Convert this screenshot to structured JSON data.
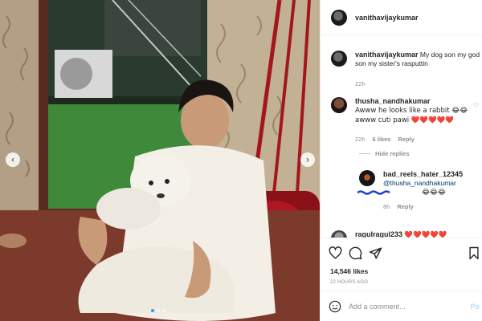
{
  "post": {
    "author": "vanithavijaykumar",
    "caption": "My dog son my god son my sister's rasputtin",
    "caption_age": "22h"
  },
  "comments": [
    {
      "username": "thusha_nandhakumar",
      "text": "Awww he looks like a rabbit 😂😂 awww cuti pawi ❤️❤️❤️❤️❤️",
      "age": "22h",
      "likes": "6 likes",
      "reply_label": "Reply"
    }
  ],
  "hide_replies_label": "Hide replies",
  "reply": {
    "username": "bad_reels_hater_12345",
    "mention": "@thusha_nandhakumar",
    "emojis": "😂😂😂",
    "age": "8h",
    "reply_label": "Reply"
  },
  "partial_comment": {
    "username": "ragulragul233",
    "text": "❤️❤️❤️❤️❤️"
  },
  "likes_count": "14,546 likes",
  "post_time": "22 HOURS AGO",
  "add_comment": {
    "placeholder": "Add a comment...",
    "post_label": "Po"
  },
  "icons": {
    "like": "heart-icon",
    "comment": "comment-icon",
    "share": "share-icon",
    "save": "bookmark-icon",
    "emoji": "emoji-icon",
    "prev": "chevron-left-icon",
    "next": "chevron-right-icon"
  },
  "carousel": {
    "slides": 3,
    "active_index": 0
  },
  "colors": {
    "link": "#00376b",
    "accent": "#3897f0",
    "scribble": "#1b3fd1",
    "heart": "#ed1c24"
  }
}
